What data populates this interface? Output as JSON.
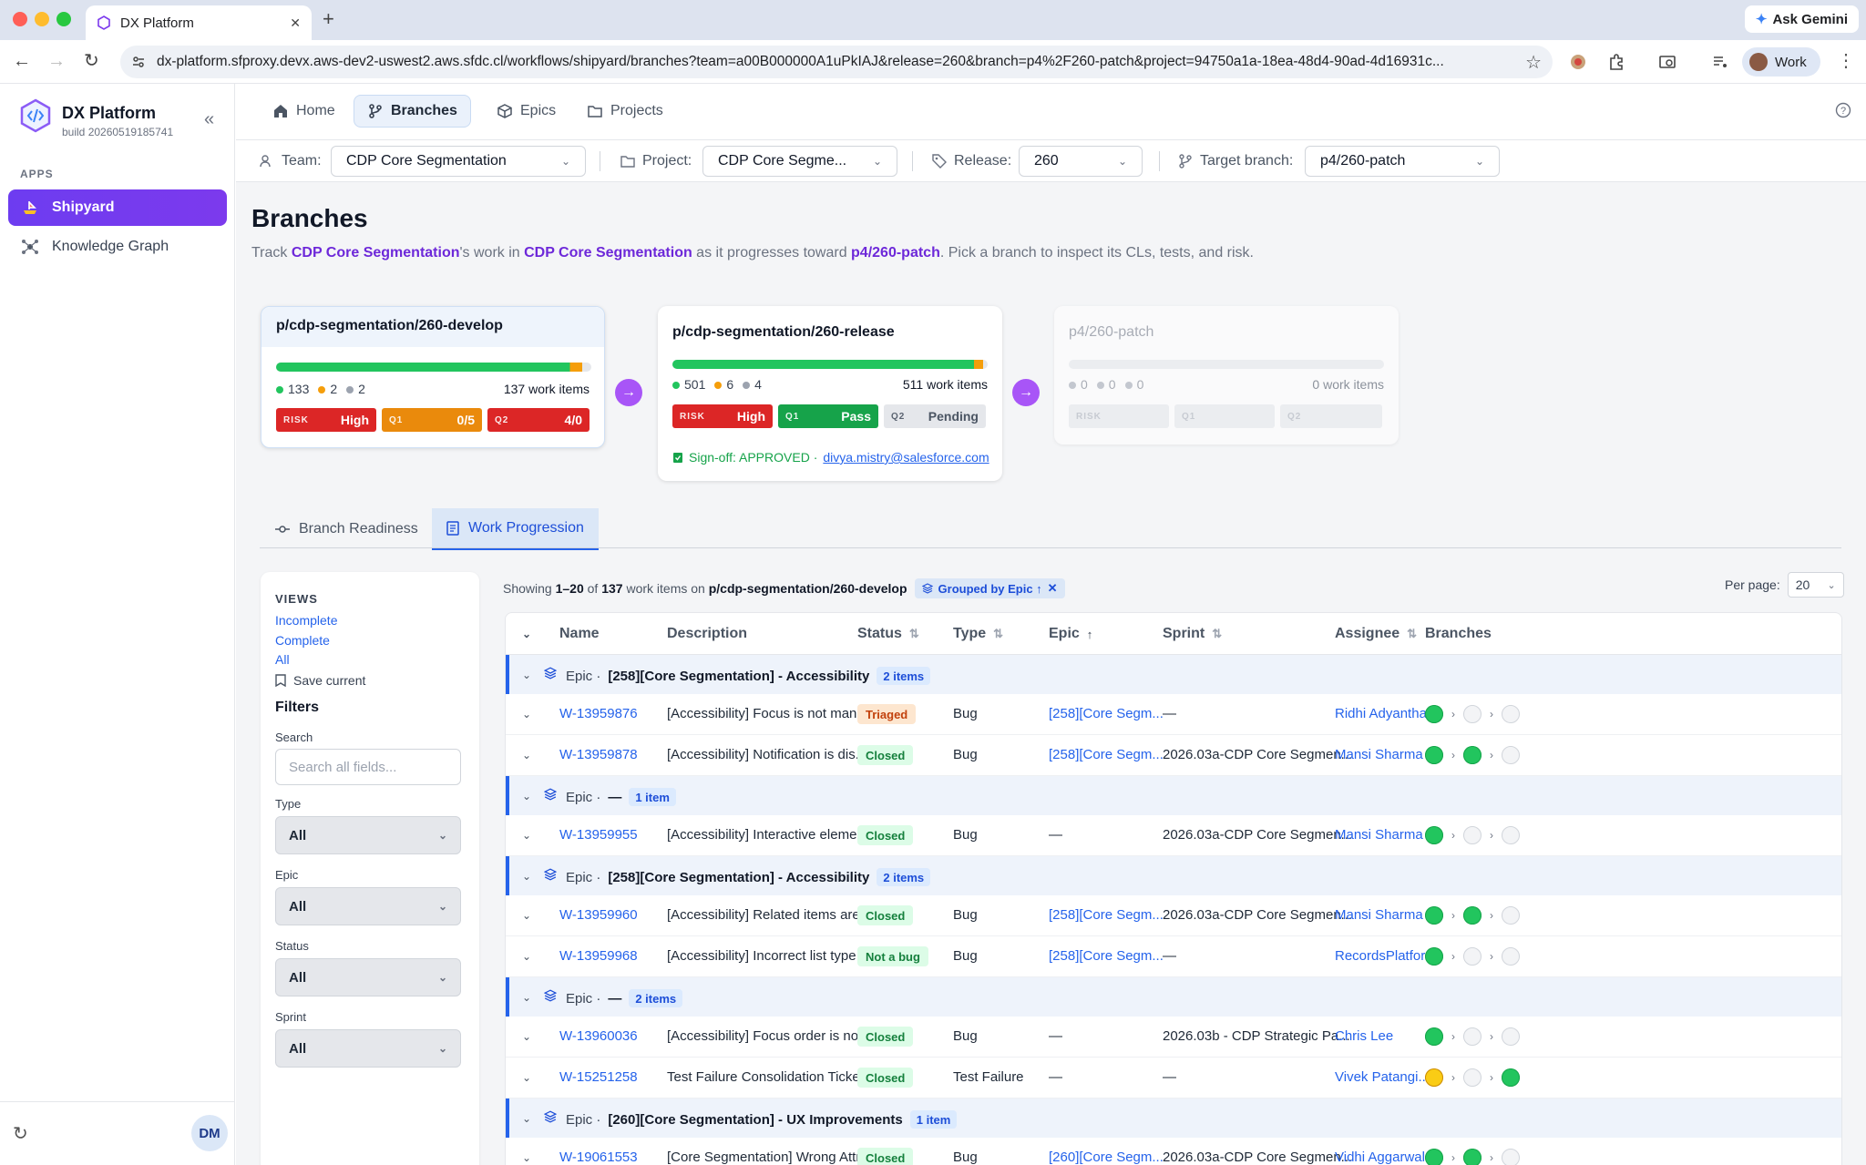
{
  "browser": {
    "tab_title": "DX Platform",
    "url": "dx-platform.sfproxy.devx.aws-dev2-uswest2.aws.sfdc.cl/workflows/shipyard/branches?team=a00B000000A1uPkIAJ&release=260&branch=p4%2F260-patch&project=94750a1a-18ea-48d4-90ad-4d16931c...",
    "ask_gemini": "Ask Gemini",
    "profile": "Work"
  },
  "sidebar": {
    "app_name": "DX Platform",
    "build": "build 20260519185741",
    "apps_label": "APPS",
    "items": [
      {
        "label": "Shipyard",
        "active": true
      },
      {
        "label": "Knowledge Graph",
        "active": false
      }
    ],
    "user_initials": "DM"
  },
  "topnav": {
    "tabs": [
      {
        "label": "Home",
        "icon": "home-icon"
      },
      {
        "label": "Branches",
        "icon": "branch-icon",
        "active": true
      },
      {
        "label": "Epics",
        "icon": "cube-icon"
      },
      {
        "label": "Projects",
        "icon": "folder-icon"
      }
    ]
  },
  "filters_bar": {
    "team_label": "Team:",
    "team_value": "CDP Core Segmentation",
    "project_label": "Project:",
    "project_value": "CDP Core Segme...",
    "release_label": "Release:",
    "release_value": "260",
    "target_label": "Target branch:",
    "target_value": "p4/260-patch"
  },
  "page": {
    "title": "Branches",
    "sub_1": "Track ",
    "sub_team": "CDP Core Segmentation",
    "sub_2": "'s work in ",
    "sub_project": "CDP Core Segmentation",
    "sub_3": " as it progresses toward ",
    "sub_target": "p4/260-patch",
    "sub_4": ". Pick a branch to inspect its CLs, tests, and risk."
  },
  "branches": [
    {
      "name": "p/cdp-segmentation/260-develop",
      "progress": 0.97,
      "green": "133",
      "orange": "2",
      "gray": "2",
      "work_items": "137 work items",
      "risk_k": "RISK",
      "risk_v": "High",
      "q1_k": "Q1",
      "q1_v": "0/5",
      "q2_k": "Q2",
      "q2_v": "4/0"
    },
    {
      "name": "p/cdp-segmentation/260-release",
      "progress": 0.985,
      "green": "501",
      "orange": "6",
      "gray": "4",
      "work_items": "511 work items",
      "risk_k": "RISK",
      "risk_v": "High",
      "q1_k": "Q1",
      "q1_v": "Pass",
      "q2_k": "Q2",
      "q2_v": "Pending",
      "signoff": "Sign-off: APPROVED · ",
      "signoff_email": "divya.mistry@salesforce.com"
    },
    {
      "name": "p4/260-patch",
      "progress": 0,
      "green": "0",
      "orange": "0",
      "gray": "0",
      "work_items": "0 work items",
      "risk_k": "RISK",
      "q1_k": "Q1",
      "q2_k": "Q2"
    }
  ],
  "section_tabs": [
    {
      "label": "Branch Readiness"
    },
    {
      "label": "Work Progression",
      "active": true
    }
  ],
  "views_panel": {
    "views_label": "VIEWS",
    "views": [
      "Incomplete",
      "Complete",
      "All"
    ],
    "save_current": "Save current",
    "filters_label": "Filters",
    "search_label": "Search",
    "search_placeholder": "Search all fields...",
    "type_label": "Type",
    "type_value": "All",
    "epic_label": "Epic",
    "epic_value": "All",
    "status_label": "Status",
    "status_value": "All",
    "sprint_label": "Sprint",
    "sprint_value": "All"
  },
  "table_meta": {
    "showing_1": "Showing ",
    "range": "1–20",
    "of": " of ",
    "total": "137",
    "on": " work items on ",
    "branch": "p/cdp-segmentation/260-develop",
    "grouped": "Grouped by Epic ↑",
    "per_page_label": "Per page:",
    "per_page_value": "20"
  },
  "columns": [
    "Name",
    "Description",
    "Status",
    "Type",
    "Epic",
    "Sprint",
    "Assignee",
    "Branches"
  ],
  "groups": [
    {
      "prefix": "Epic ·",
      "title": "[258][Core Segmentation] - Accessibility",
      "count": "2 items",
      "rows": [
        {
          "id": "W-13959876",
          "desc": "[Accessibility] Focus is not mana...",
          "status": "Triaged",
          "status_kind": "triaged",
          "type": "Bug",
          "epic": "[258][Core Segm...",
          "sprint": "—",
          "assignee": "Ridhi Adyantha...",
          "branches": [
            "g",
            "e",
            "e"
          ]
        },
        {
          "id": "W-13959878",
          "desc": "[Accessibility] Notification is dis...",
          "status": "Closed",
          "status_kind": "closed",
          "type": "Bug",
          "epic": "[258][Core Segm...",
          "sprint": "2026.03a-CDP Core Segmen...",
          "assignee": "Mansi Sharma",
          "branches": [
            "g",
            "g",
            "e"
          ]
        }
      ]
    },
    {
      "prefix": "Epic ·",
      "title": "—",
      "count": "1 item",
      "rows": [
        {
          "id": "W-13959955",
          "desc": "[Accessibility] Interactive eleme...",
          "status": "Closed",
          "status_kind": "closed",
          "type": "Bug",
          "epic": "—",
          "sprint": "2026.03a-CDP Core Segmen...",
          "assignee": "Mansi Sharma",
          "branches": [
            "g",
            "e",
            "e"
          ]
        }
      ]
    },
    {
      "prefix": "Epic ·",
      "title": "[258][Core Segmentation] - Accessibility",
      "count": "2 items",
      "rows": [
        {
          "id": "W-13959960",
          "desc": "[Accessibility] Related items are ...",
          "status": "Closed",
          "status_kind": "closed",
          "type": "Bug",
          "epic": "[258][Core Segm...",
          "sprint": "2026.03a-CDP Core Segmen...",
          "assignee": "Mansi Sharma",
          "branches": [
            "g",
            "g",
            "e"
          ]
        },
        {
          "id": "W-13959968",
          "desc": "[Accessibility] Incorrect list type ...",
          "status": "Not a bug",
          "status_kind": "notbug",
          "type": "Bug",
          "epic": "[258][Core Segm...",
          "sprint": "—",
          "assignee": "RecordsPlatfor...",
          "branches": [
            "g",
            "e",
            "e"
          ]
        }
      ]
    },
    {
      "prefix": "Epic ·",
      "title": "—",
      "count": "2 items",
      "rows": [
        {
          "id": "W-13960036",
          "desc": "[Accessibility] Focus order is not...",
          "status": "Closed",
          "status_kind": "closed",
          "type": "Bug",
          "epic": "—",
          "sprint": "2026.03b - CDP Strategic Pa...",
          "assignee": "Chris Lee",
          "branches": [
            "g",
            "e",
            "e"
          ]
        },
        {
          "id": "W-15251258",
          "desc": "Test Failure Consolidation Ticket",
          "status": "Closed",
          "status_kind": "closed",
          "type": "Test Failure",
          "epic": "—",
          "sprint": "—",
          "assignee": "Vivek Patangi...",
          "branches": [
            "y",
            "e",
            "g"
          ]
        }
      ]
    },
    {
      "prefix": "Epic ·",
      "title": "[260][Core Segmentation] - UX Improvements",
      "count": "1 item",
      "rows": [
        {
          "id": "W-19061553",
          "desc": "[Core Segmentation] Wrong Attri...",
          "status": "Closed",
          "status_kind": "closed",
          "type": "Bug",
          "epic": "[260][Core Segm...",
          "sprint": "2026.03a-CDP Core Segmen...",
          "assignee": "Vidhi Aggarwal",
          "branches": [
            "g",
            "g",
            "e"
          ]
        }
      ]
    }
  ],
  "colors": {
    "accent": "#2563eb",
    "brand_purple": "#7c3aed",
    "risk_red": "#dc2626",
    "warn_orange": "#ea8a0c",
    "pass_green": "#16a34a"
  }
}
